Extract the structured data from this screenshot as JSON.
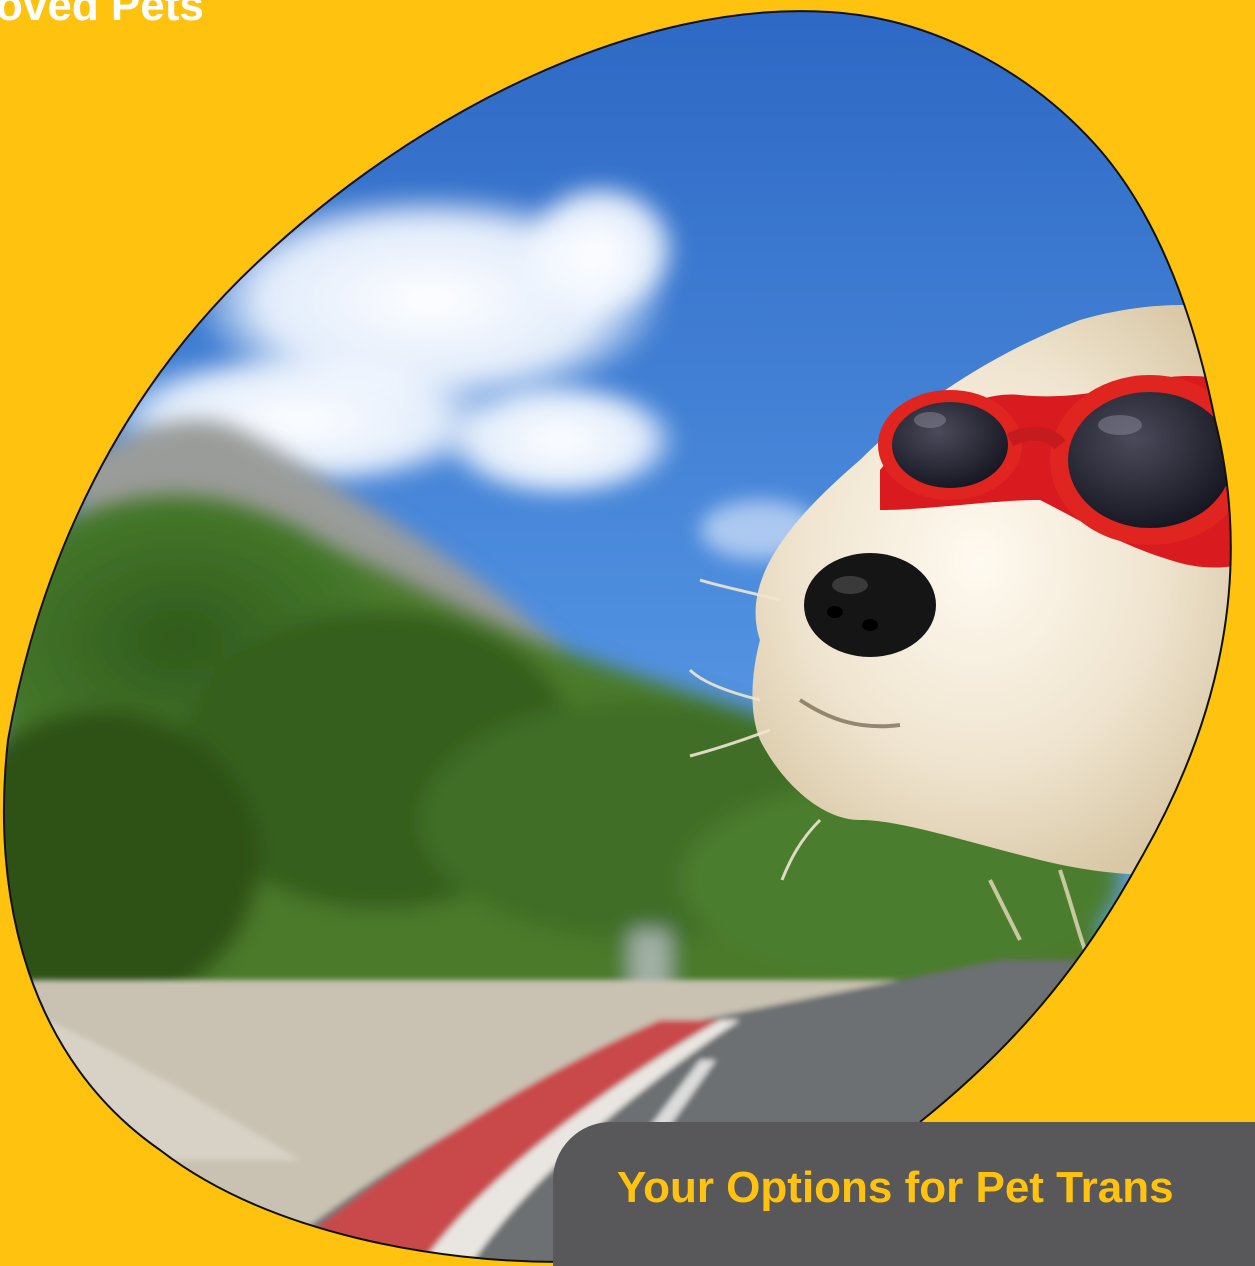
{
  "header": {
    "title": "oved Pets"
  },
  "hero": {
    "image_icon": "dog-with-goggles-photo",
    "blob_outline_color": "#111111"
  },
  "caption": {
    "text": "Your Options for Pet Trans"
  },
  "colors": {
    "background": "#FFC20E",
    "caption_bg": "#58585a",
    "caption_text": "#FFC20E",
    "heading_text": "#FFFFFF"
  }
}
